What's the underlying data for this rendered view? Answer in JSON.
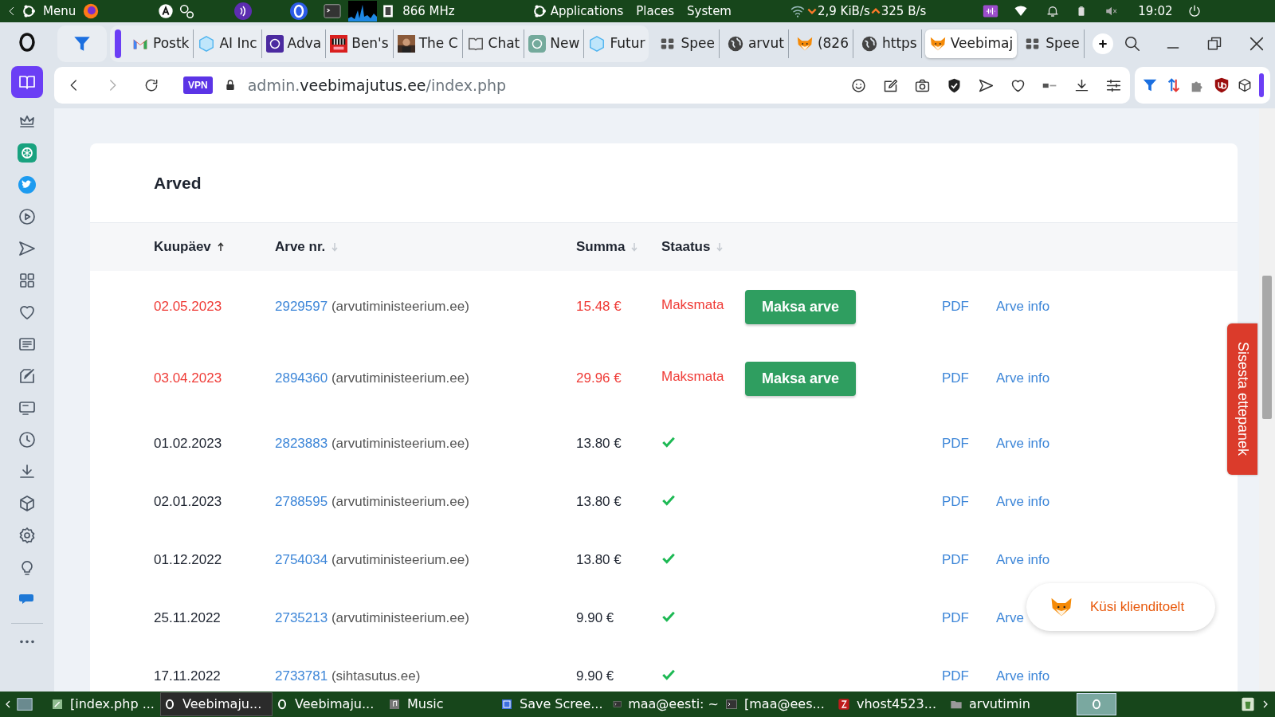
{
  "top_panel": {
    "menu": "Menu",
    "cpu": "866 MHz",
    "menus": [
      "Applications",
      "Places",
      "System"
    ],
    "net_down": "2,9 KiB/s",
    "net_up": "325 B/s",
    "clock": "19:02"
  },
  "sidebar": [
    {
      "kind": "workspace",
      "selected": true
    },
    {
      "kind": "crown",
      "selected": false
    },
    {
      "kind": "chatgpt",
      "selected": false
    },
    {
      "kind": "twitter",
      "selected": false
    },
    {
      "kind": "player",
      "selected": false
    },
    {
      "kind": "send",
      "selected": false
    },
    {
      "kind": "grid",
      "selected": false
    },
    {
      "kind": "heart",
      "selected": false
    },
    {
      "kind": "news",
      "selected": false
    },
    {
      "kind": "pen",
      "selected": false
    },
    {
      "kind": "screen",
      "selected": false
    },
    {
      "kind": "clock",
      "selected": false
    },
    {
      "kind": "download",
      "selected": false
    },
    {
      "kind": "cube",
      "selected": false
    },
    {
      "kind": "gear",
      "selected": false
    },
    {
      "kind": "bulb",
      "selected": false
    },
    {
      "kind": "chat",
      "selected": false
    },
    {
      "kind": "more",
      "selected": false
    }
  ],
  "tabs": [
    {
      "title": "Postk",
      "kind": "mail",
      "selected": false
    },
    {
      "title": "AI Inc",
      "kind": "hex",
      "selected": false
    },
    {
      "title": "Adva",
      "kind": "knot-dark",
      "selected": false
    },
    {
      "title": "Ben's",
      "kind": "grille",
      "selected": false
    },
    {
      "title": "The C",
      "selected": false
    },
    {
      "title": "Chat",
      "kind": "book",
      "selected": false
    },
    {
      "title": "New",
      "kind": "knot",
      "selected": false
    },
    {
      "title": "Futur",
      "kind": "hex",
      "selected": false
    },
    {
      "title": "Spee",
      "kind": "speed",
      "selected": false
    },
    {
      "title": "arvut",
      "kind": "globe",
      "selected": false
    },
    {
      "title": "(826",
      "kind": "fox",
      "selected": false
    },
    {
      "title": "https",
      "kind": "globe",
      "selected": false
    },
    {
      "title": "Veebimaj",
      "kind": "fox",
      "selected": true
    },
    {
      "title": "Spee",
      "kind": "speed",
      "selected": false
    }
  ],
  "address_bar": {
    "vpn": "VPN",
    "url_prefix": "admin.",
    "url_domain": "veebimajutus.ee",
    "url_path": "/index.php"
  },
  "invoices": {
    "title": "Arved",
    "columns": [
      {
        "label": "Kuupäev",
        "selected": true,
        "ascending": true
      },
      {
        "label": "Arve nr.",
        "selected": false,
        "ascending": false
      },
      {
        "label": "Summa",
        "selected": false,
        "ascending": false
      },
      {
        "label": "Staatus",
        "selected": false,
        "ascending": false
      }
    ],
    "rows": [
      {
        "date": "02.05.2023",
        "number": "2929597",
        "client": "(arvutiministeerium.ee)",
        "amount": "15.48 €",
        "paid": false,
        "status": "Maksmata",
        "pay_button": "Maksa arve",
        "pdf": "PDF",
        "info": "Arve info"
      },
      {
        "date": "03.04.2023",
        "number": "2894360",
        "client": "(arvutiministeerium.ee)",
        "amount": "29.96 €",
        "paid": false,
        "status": "Maksmata",
        "pay_button": "Maksa arve",
        "pdf": "PDF",
        "info": "Arve info"
      },
      {
        "date": "01.02.2023",
        "number": "2823883",
        "client": "(arvutiministeerium.ee)",
        "amount": "13.80 €",
        "paid": true,
        "pdf": "PDF",
        "info": "Arve info"
      },
      {
        "date": "02.01.2023",
        "number": "2788595",
        "client": "(arvutiministeerium.ee)",
        "amount": "13.80 €",
        "paid": true,
        "pdf": "PDF",
        "info": "Arve info"
      },
      {
        "date": "01.12.2022",
        "number": "2754034",
        "client": "(arvutiministeerium.ee)",
        "amount": "13.80 €",
        "paid": true,
        "pdf": "PDF",
        "info": "Arve info"
      },
      {
        "date": "25.11.2022",
        "number": "2735213",
        "client": "(arvutiministeerium.ee)",
        "amount": "9.90 €",
        "paid": true,
        "pdf": "PDF",
        "info": "Arve"
      },
      {
        "date": "17.11.2022",
        "number": "2733781",
        "client": "(sihtasutus.ee)",
        "amount": "9.90 €",
        "paid": true,
        "pdf": "PDF",
        "info": "Arve info"
      }
    ]
  },
  "feedback_tab": "Sisesta ettepanek",
  "support_chat": "Küsi klienditoelt",
  "taskbar": [
    {
      "title": "[index.php ...",
      "kind": "editor",
      "selected": false
    },
    {
      "title": "Veebimaju...",
      "kind": "opera",
      "selected": true
    },
    {
      "title": "Veebimaju...",
      "kind": "opera",
      "selected": false
    },
    {
      "title": "Music",
      "kind": "music",
      "selected": false
    },
    {
      "title": "Save Scree...",
      "kind": "screenshot",
      "selected": false
    },
    {
      "title": "maa@eesti: ~",
      "kind": "terminal",
      "selected": false
    },
    {
      "title": "[maa@ees...",
      "kind": "terminal",
      "selected": false
    },
    {
      "title": "vhost4523...",
      "kind": "filezilla",
      "selected": false
    },
    {
      "title": "arvutimin",
      "kind": "folder",
      "selected": false
    }
  ]
}
